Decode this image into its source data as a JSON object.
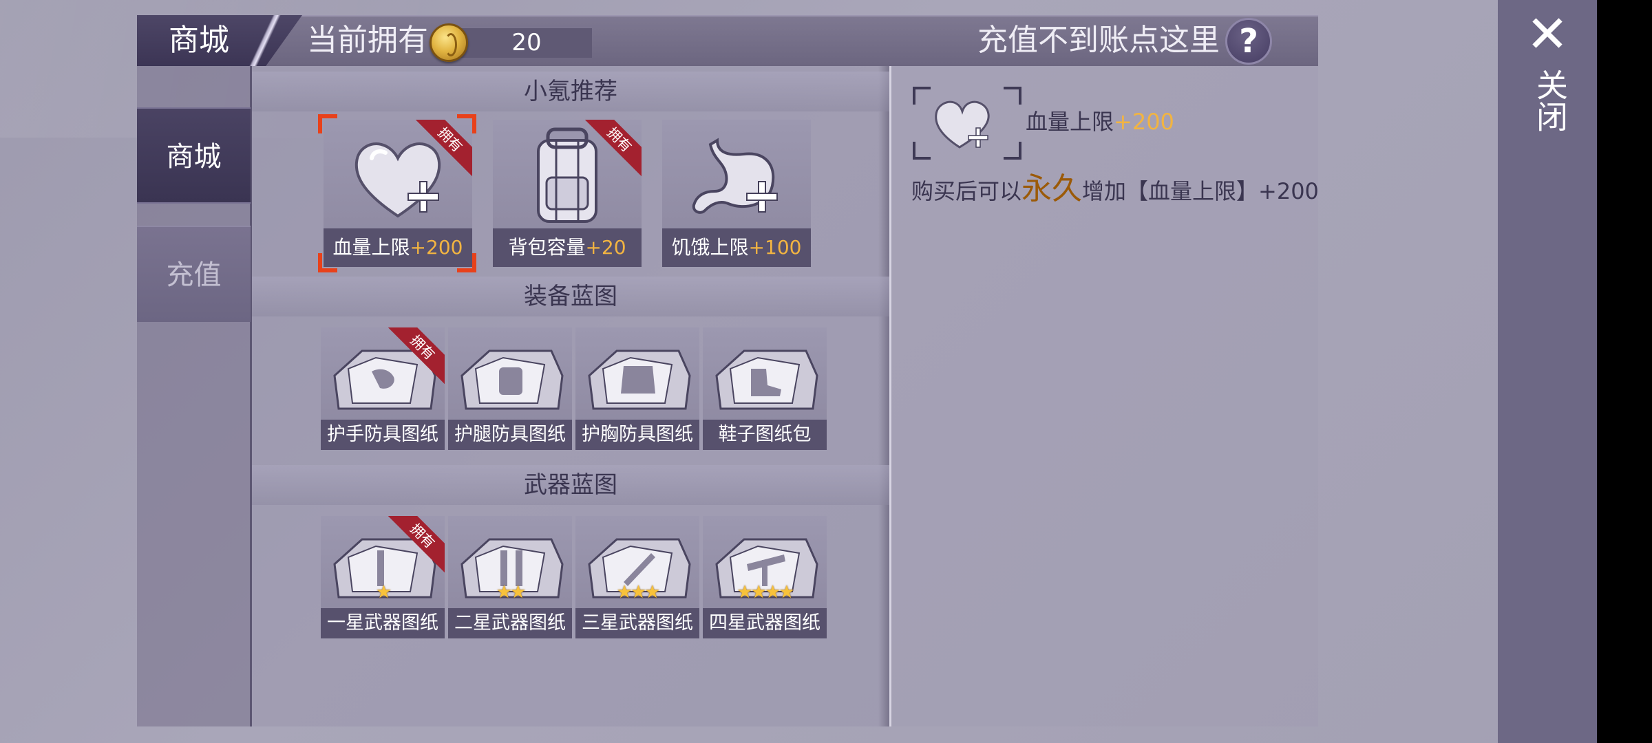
{
  "header": {
    "tab_title": "商城",
    "owned_label": "当前拥有",
    "coin_count": "20",
    "help_text": "充值不到账点这里",
    "help_icon": "question-mark-icon"
  },
  "sidebar": {
    "items": [
      {
        "label": "商城",
        "active": true
      },
      {
        "label": "充值",
        "active": false
      }
    ]
  },
  "sections": {
    "recommended": {
      "title": "小氪推荐",
      "items": [
        {
          "name": "血量上限",
          "bonus": "+200",
          "owned_badge": "拥有",
          "icon": "heart-plus-icon",
          "selected": true
        },
        {
          "name": "背包容量",
          "bonus": "+20",
          "owned_badge": "拥有",
          "icon": "backpack-icon"
        },
        {
          "name": "饥饿上限",
          "bonus": "+100",
          "icon": "stomach-plus-icon"
        }
      ]
    },
    "equipment": {
      "title": "装备蓝图",
      "items": [
        {
          "name": "护手防具图纸",
          "owned_badge": "拥有",
          "icon": "glove-blueprint-icon"
        },
        {
          "name": "护腿防具图纸",
          "icon": "leg-armor-blueprint-icon"
        },
        {
          "name": "护胸防具图纸",
          "icon": "chest-armor-blueprint-icon"
        },
        {
          "name": "鞋子图纸包",
          "icon": "shoe-blueprint-icon"
        }
      ]
    },
    "weapons": {
      "title": "武器蓝图",
      "items": [
        {
          "name": "一星武器图纸",
          "owned_badge": "拥有",
          "stars": 1,
          "star_glyphs": "★",
          "icon": "weapon-blueprint-icon"
        },
        {
          "name": "二星武器图纸",
          "stars": 2,
          "star_glyphs": "★★",
          "icon": "weapon-blueprint-icon"
        },
        {
          "name": "三星武器图纸",
          "stars": 3,
          "star_glyphs": "★★★",
          "icon": "weapon-blueprint-icon"
        },
        {
          "name": "四星武器图纸",
          "stars": 4,
          "star_glyphs": "★★★★",
          "icon": "weapon-blueprint-icon"
        }
      ]
    }
  },
  "detail": {
    "name": "血量上限",
    "bonus": "+200",
    "desc_prefix": "购买后可以",
    "desc_emphasis": "永久",
    "desc_suffix": "增加【血量上限】+200"
  },
  "close": {
    "label": "关闭",
    "icon": "close-x-icon"
  },
  "colors": {
    "accent_gold": "#f2b441",
    "selection_orange": "#e8411a",
    "owned_ribbon": "#a3212f",
    "panel_purple": "#6d6885"
  }
}
